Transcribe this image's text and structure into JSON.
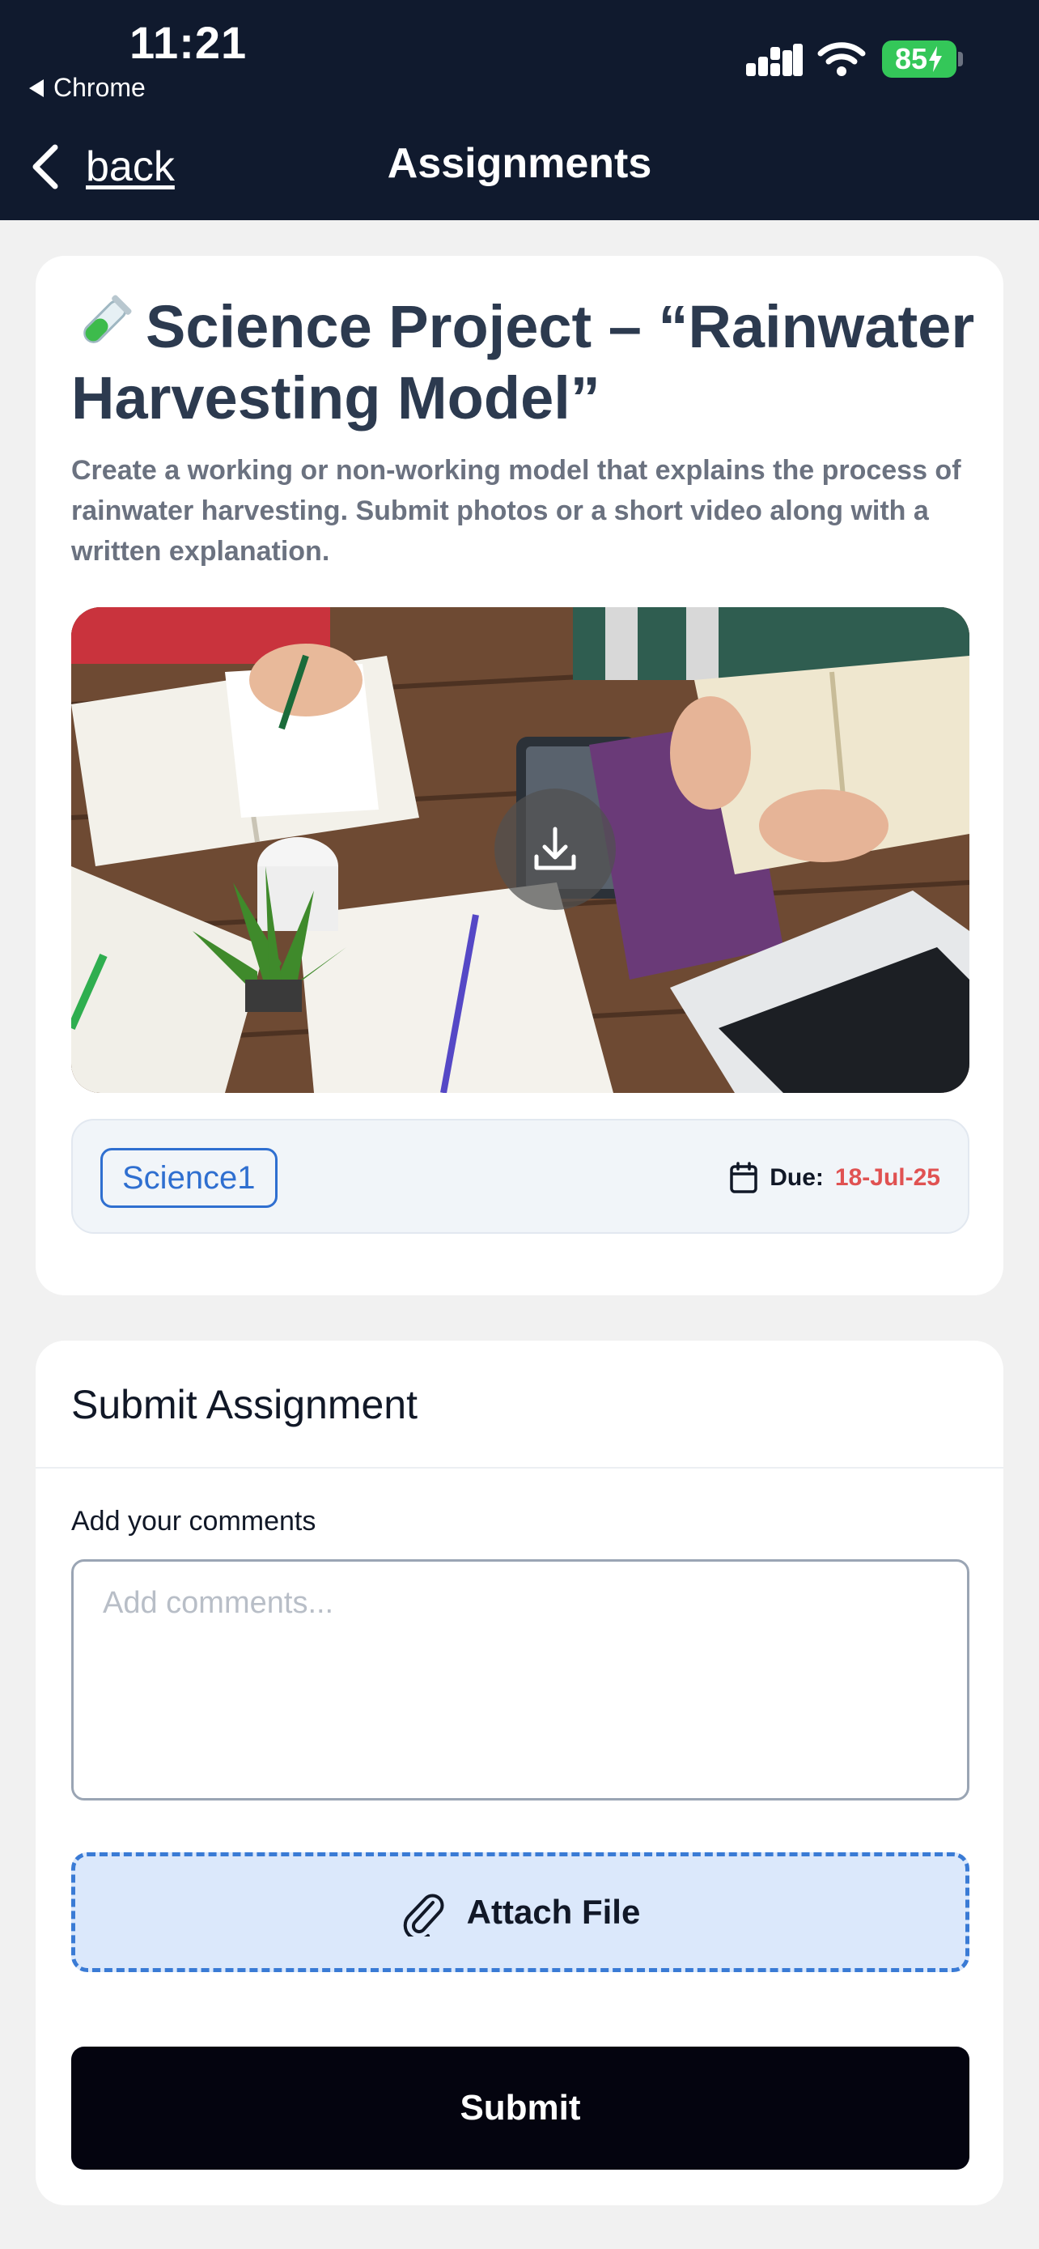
{
  "status_bar": {
    "time": "11:21",
    "back_app": "Chrome",
    "battery": "85"
  },
  "nav": {
    "back_label": "back",
    "title": "Assignments"
  },
  "assignment": {
    "title": "Science Project – “Rainwater Harvesting Model”",
    "title_icon": "test-tube-icon",
    "description": "Create a working or non-working model that explains the process of rainwater harvesting. Submit photos or a short video along with a written explanation.",
    "image_icon": "download-icon",
    "tag": "Science1",
    "due_label": "Due:",
    "due_date": "18-Jul-25"
  },
  "submission": {
    "heading": "Submit Assignment",
    "comments_label": "Add your comments",
    "comments_placeholder": "Add comments...",
    "comments_value": "",
    "attach_label": "Attach File",
    "submit_label": "Submit"
  },
  "colors": {
    "header_bg": "#101a2e",
    "tag_blue": "#2f6fd0",
    "due_red": "#e05252",
    "attach_bg": "#dbe8fb",
    "submit_bg": "#04040f",
    "battery_green": "#34c759"
  }
}
